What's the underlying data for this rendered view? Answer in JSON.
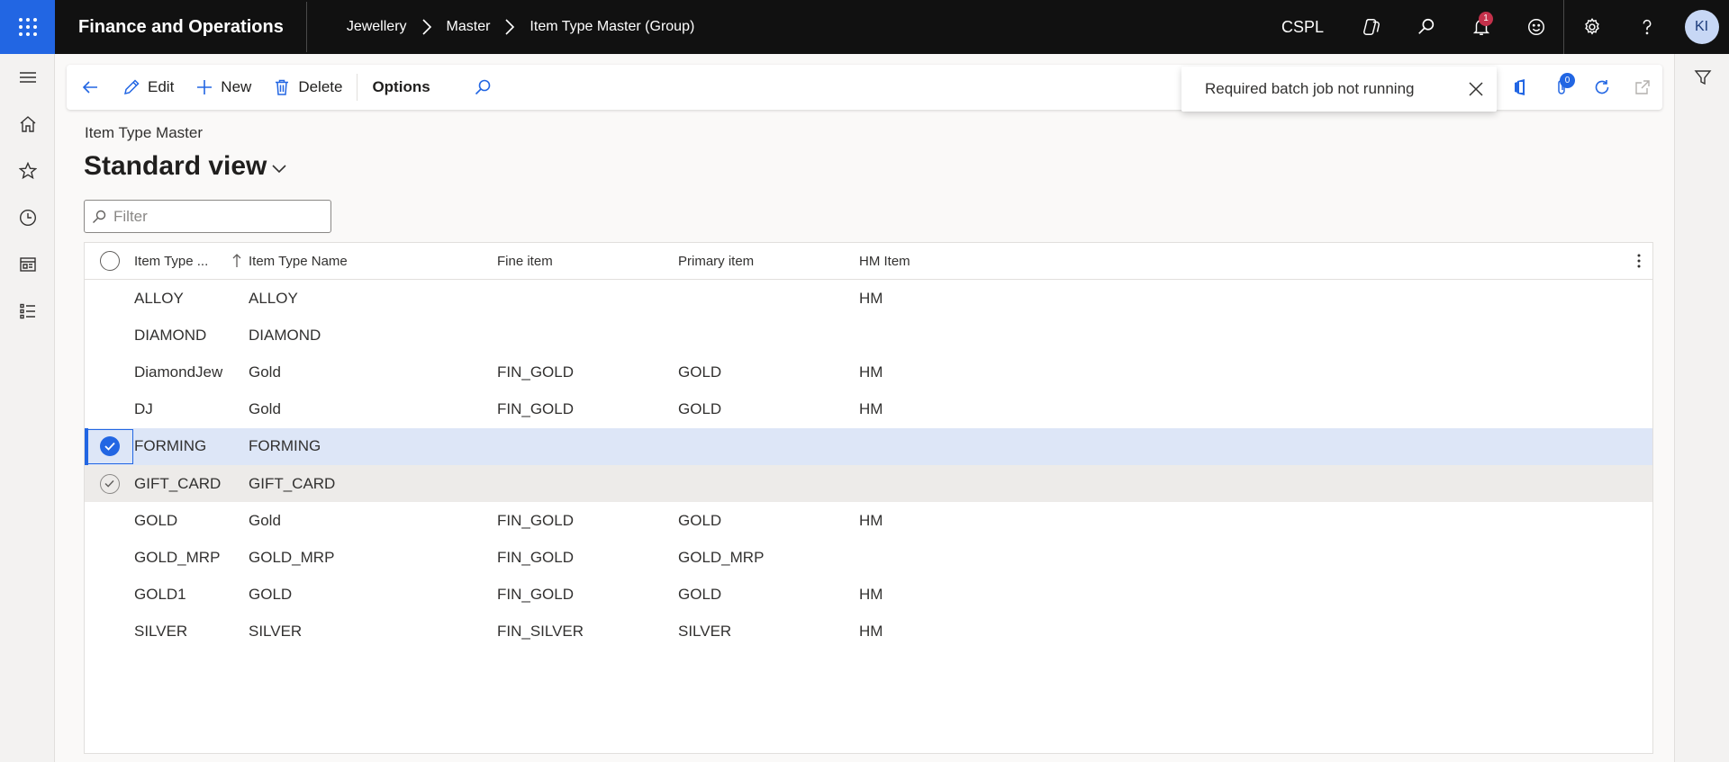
{
  "topbar": {
    "app_title": "Finance and Operations",
    "breadcrumb": [
      "Jewellery",
      "Master",
      "Item Type Master (Group)"
    ],
    "company": "CSPL",
    "notification_count": "1",
    "avatar_initials": "KI"
  },
  "actionpane": {
    "edit_label": "Edit",
    "new_label": "New",
    "delete_label": "Delete",
    "options_label": "Options",
    "attachments_count": "0"
  },
  "toast": {
    "message": "Required batch job not running"
  },
  "page": {
    "caption": "Item Type Master",
    "view_title": "Standard view"
  },
  "filter": {
    "placeholder": "Filter"
  },
  "grid": {
    "columns": [
      "Item Type ...",
      "Item Type Name",
      "Fine item",
      "Primary item",
      "HM Item"
    ],
    "rows": [
      {
        "type": "ALLOY",
        "name": "ALLOY",
        "fine": "",
        "primary": "",
        "hm": "HM"
      },
      {
        "type": "DIAMOND",
        "name": "DIAMOND",
        "fine": "",
        "primary": "",
        "hm": ""
      },
      {
        "type": "DiamondJew",
        "name": "Gold",
        "fine": "FIN_GOLD",
        "primary": "GOLD",
        "hm": "HM"
      },
      {
        "type": "DJ",
        "name": "Gold",
        "fine": "FIN_GOLD",
        "primary": "GOLD",
        "hm": "HM"
      },
      {
        "type": "FORMING",
        "name": "FORMING",
        "fine": "",
        "primary": "",
        "hm": ""
      },
      {
        "type": "GIFT_CARD",
        "name": "GIFT_CARD",
        "fine": "",
        "primary": "",
        "hm": ""
      },
      {
        "type": "GOLD",
        "name": "Gold",
        "fine": "FIN_GOLD",
        "primary": "GOLD",
        "hm": "HM"
      },
      {
        "type": "GOLD_MRP",
        "name": "GOLD_MRP",
        "fine": "FIN_GOLD",
        "primary": "GOLD_MRP",
        "hm": ""
      },
      {
        "type": "GOLD1",
        "name": "GOLD",
        "fine": "FIN_GOLD",
        "primary": "GOLD",
        "hm": "HM"
      },
      {
        "type": "SILVER",
        "name": "SILVER",
        "fine": "FIN_SILVER",
        "primary": "SILVER",
        "hm": "HM"
      }
    ]
  },
  "colors": {
    "accent": "#2266e3",
    "topbar_bg": "#111111",
    "selected_row": "#dde6f7",
    "notification_badge": "#c4314b"
  }
}
